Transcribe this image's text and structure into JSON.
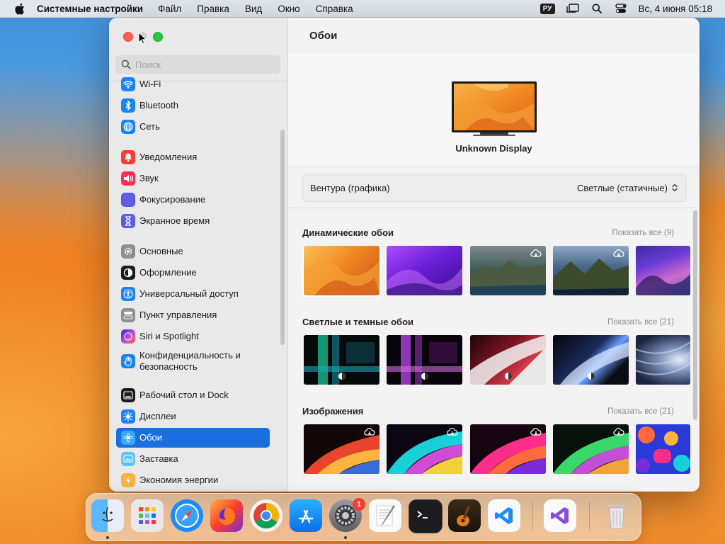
{
  "menubar": {
    "app_name": "Системные настройки",
    "items": [
      "Файл",
      "Правка",
      "Вид",
      "Окно",
      "Справка"
    ],
    "input_source": "РУ",
    "datetime": "Вс, 4 июня  05:18"
  },
  "sidebar": {
    "search_placeholder": "Поиск",
    "items": [
      {
        "label": "Wi-Fi",
        "icon": "wifi-icon",
        "color": "#1a84ff"
      },
      {
        "label": "Bluetooth",
        "icon": "bluetooth-icon",
        "color": "#1a84ff"
      },
      {
        "label": "Сеть",
        "icon": "globe-icon",
        "color": "#1a84ff"
      },
      {
        "label": "Уведомления",
        "icon": "bell-icon",
        "color": "#ff3b30"
      },
      {
        "label": "Звук",
        "icon": "speaker-icon",
        "color": "#ff2d55"
      },
      {
        "label": "Фокусирование",
        "icon": "moon-icon",
        "color": "#5e5ce6"
      },
      {
        "label": "Экранное время",
        "icon": "hourglass-icon",
        "color": "#5e5ce6"
      },
      {
        "label": "Основные",
        "icon": "gear-icon",
        "color": "#8e8e93"
      },
      {
        "label": "Оформление",
        "icon": "appearance-icon",
        "color": "#1c1c1e"
      },
      {
        "label": "Универсальный доступ",
        "icon": "accessibility-icon",
        "color": "#1a84ff"
      },
      {
        "label": "Пункт управления",
        "icon": "control-center-icon",
        "color": "#8e8e93"
      },
      {
        "label": "Siri и Spotlight",
        "icon": "siri-icon",
        "color": "#c44fd6"
      },
      {
        "label": "Конфиденциальность и безопасность",
        "icon": "hand-icon",
        "color": "#1a84ff"
      },
      {
        "label": "Рабочий стол и Dock",
        "icon": "dock-icon",
        "color": "#1c1c1e"
      },
      {
        "label": "Дисплеи",
        "icon": "sun-icon",
        "color": "#1a84ff"
      },
      {
        "label": "Обои",
        "icon": "wallpaper-icon",
        "color": "#35aaff"
      },
      {
        "label": "Заставка",
        "icon": "screensaver-icon",
        "color": "#5ac8fa"
      },
      {
        "label": "Экономия энергии",
        "icon": "battery-icon",
        "color": "#ffb340"
      }
    ]
  },
  "main": {
    "title": "Обои",
    "display_name": "Unknown Display",
    "wallpaper_name": "Вентура (графика)",
    "wallpaper_mode": "Светлые (статичные)",
    "sections": [
      {
        "title": "Динамические обои",
        "show_all": "Показать все (9)"
      },
      {
        "title": "Светлые и темные обои",
        "show_all": "Показать все (21)"
      },
      {
        "title": "Изображения",
        "show_all": "Показать все (21)"
      }
    ]
  },
  "dock": {
    "apps": [
      "Finder",
      "Launchpad",
      "Safari",
      "Firefox",
      "Chrome",
      "App Store",
      "Системные настройки",
      "TextEdit",
      "Терминал",
      "GarageBand",
      "Visual Studio Code",
      "Visual Studio",
      "Корзина"
    ],
    "settings_badge": "1"
  }
}
